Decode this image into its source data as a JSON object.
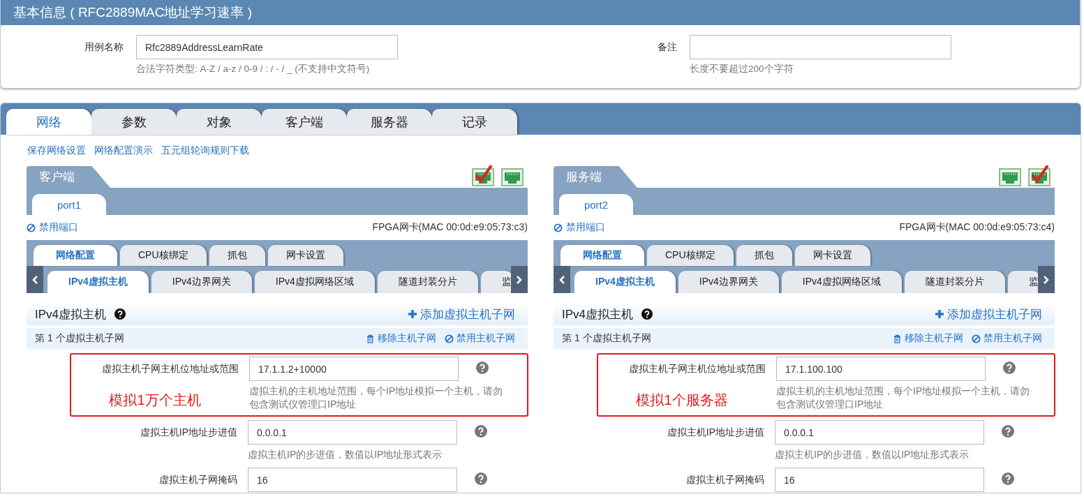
{
  "basic_info": {
    "title": "基本信息 ( RFC2889MAC地址学习速率 )",
    "fields": [
      {
        "label": "用例名称",
        "value": "Rfc2889AddressLearnRate",
        "hint": "合法字符类型: A-Z / a-z / 0-9 / : / - / _ (不支持中文符号)"
      },
      {
        "label": "备注",
        "hint": "长度不要超过200个字符"
      }
    ]
  },
  "main_tabs": [
    {
      "label": "网络",
      "selected": true
    },
    {
      "label": "参数",
      "selected": false
    },
    {
      "label": "对象",
      "selected": false
    },
    {
      "label": "客户端",
      "selected": false
    },
    {
      "label": "服务器",
      "selected": false
    },
    {
      "label": "记录",
      "selected": false
    }
  ],
  "links": [
    "保存网络设置",
    "网络配置演示",
    "五元组轮询规则下载"
  ],
  "panels": [
    {
      "title": "客户端",
      "status_icons": [
        {
          "checked": true
        },
        {
          "checked": false
        }
      ],
      "port_tab": "port1",
      "disable_port": "禁用端口",
      "nic_info": "FPGA网卡(MAC 00:0d:e9:05:73:c3)",
      "config_tabs": [
        {
          "label": "网络配置",
          "selected": true
        },
        {
          "label": "CPU核绑定",
          "selected": false
        },
        {
          "label": "抓包",
          "selected": false
        },
        {
          "label": "网卡设置",
          "selected": false
        }
      ],
      "sub_tabs": [
        {
          "label": "IPv4虚拟主机",
          "selected": true
        },
        {
          "label": "IPv4边界网关",
          "selected": false
        },
        {
          "label": "IPv4虚拟网络区域",
          "selected": false
        },
        {
          "label": "隧道封装分片",
          "selected": false
        },
        {
          "label": "监",
          "selected": false
        }
      ],
      "section_title": "IPv4虚拟主机",
      "add_subnet": "添加虚拟主机子网",
      "subnet_title": "第 1 个虚拟主机子网",
      "remove_subnet": "移除主机子网",
      "disable_subnet": "禁用主机子网",
      "fields": [
        {
          "label": "虚拟主机子网主机位地址或范围",
          "value": "17.1.1.2+10000",
          "hint": "虚拟主机的主机地址范围，每个IP地址模拟一个主机，请勿包含测试仪管理口IP地址",
          "note": "模拟1万个主机"
        },
        {
          "label": "虚拟主机IP地址步进值",
          "value": "0.0.0.1",
          "hint": "虚拟主机IP的步进值，数值以IP地址形式表示"
        },
        {
          "label": "虚拟主机子网掩码",
          "value": "16"
        }
      ]
    },
    {
      "title": "服务端",
      "status_icons": [
        {
          "checked": false
        },
        {
          "checked": true
        }
      ],
      "port_tab": "port2",
      "disable_port": "禁用端口",
      "nic_info": "FPGA网卡(MAC 00:0d:e9:05:73:c4)",
      "config_tabs": [
        {
          "label": "网络配置",
          "selected": true
        },
        {
          "label": "CPU核绑定",
          "selected": false
        },
        {
          "label": "抓包",
          "selected": false
        },
        {
          "label": "网卡设置",
          "selected": false
        }
      ],
      "sub_tabs": [
        {
          "label": "IPv4虚拟主机",
          "selected": true
        },
        {
          "label": "IPv4边界网关",
          "selected": false
        },
        {
          "label": "IPv4虚拟网络区域",
          "selected": false
        },
        {
          "label": "隧道封装分片",
          "selected": false
        },
        {
          "label": "监",
          "selected": false
        }
      ],
      "section_title": "IPv4虚拟主机",
      "add_subnet": "添加虚拟主机子网",
      "subnet_title": "第 1 个虚拟主机子网",
      "remove_subnet": "移除主机子网",
      "disable_subnet": "禁用主机子网",
      "fields": [
        {
          "label": "虚拟主机子网主机位地址或范围",
          "value": "17.1.100.100",
          "hint": "虚拟主机的主机地址范围，每个IP地址模拟一个主机，请勿包含测试仪管理口IP地址",
          "note": "模拟1个服务器"
        },
        {
          "label": "虚拟主机IP地址步进值",
          "value": "0.0.0.1",
          "hint": "虚拟主机IP的步进值，数值以IP地址形式表示"
        },
        {
          "label": "虚拟主机子网掩码",
          "value": "16"
        }
      ]
    }
  ]
}
